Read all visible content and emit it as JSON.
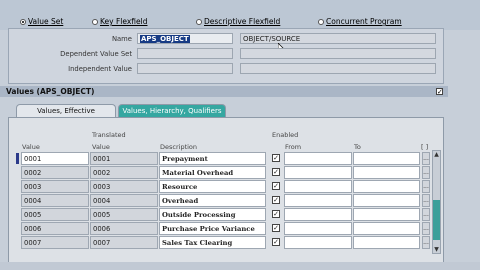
{
  "radio_options": [
    {
      "label": "Value Set",
      "selected": true
    },
    {
      "label": "Key Flexfield",
      "selected": false
    },
    {
      "label": "Descriptive Flexfield",
      "selected": false
    },
    {
      "label": "Concurrent Program",
      "selected": false
    }
  ],
  "upper": {
    "name_label": "Name",
    "name_value": "APS_OBJECT",
    "name_desc": "OBJECT/SOURCE",
    "dependent_label": "Dependent Value Set",
    "independent_label": "Independent Value"
  },
  "values_section": {
    "title": "Values (APS_OBJECT)",
    "tabs": [
      "Values, Effective",
      "Values, Hierarchy, Qualifiers"
    ]
  },
  "table": {
    "headers": {
      "value": "Value",
      "translated_top": "Translated",
      "translated_bottom": "Value",
      "description": "Description",
      "enabled": "Enabled",
      "from": "From",
      "to": "To",
      "bracket": "[ ]"
    },
    "rows": [
      {
        "value": "0001",
        "translated": "0001",
        "description": "Prepayment"
      },
      {
        "value": "0002",
        "translated": "0002",
        "description": "Material Overhead"
      },
      {
        "value": "0003",
        "translated": "0003",
        "description": "Resource"
      },
      {
        "value": "0004",
        "translated": "0004",
        "description": "Overhead"
      },
      {
        "value": "0005",
        "translated": "0005",
        "description": "Outside Processing"
      },
      {
        "value": "0006",
        "translated": "0006",
        "description": "Purchase Price Variance"
      },
      {
        "value": "0007",
        "translated": "0007",
        "description": "Sales Tax Clearing"
      }
    ],
    "row_dots": "..."
  },
  "colors": {
    "selection": "#163a84",
    "active_tab": "#35a7a1",
    "panel": "#cfd5de"
  }
}
